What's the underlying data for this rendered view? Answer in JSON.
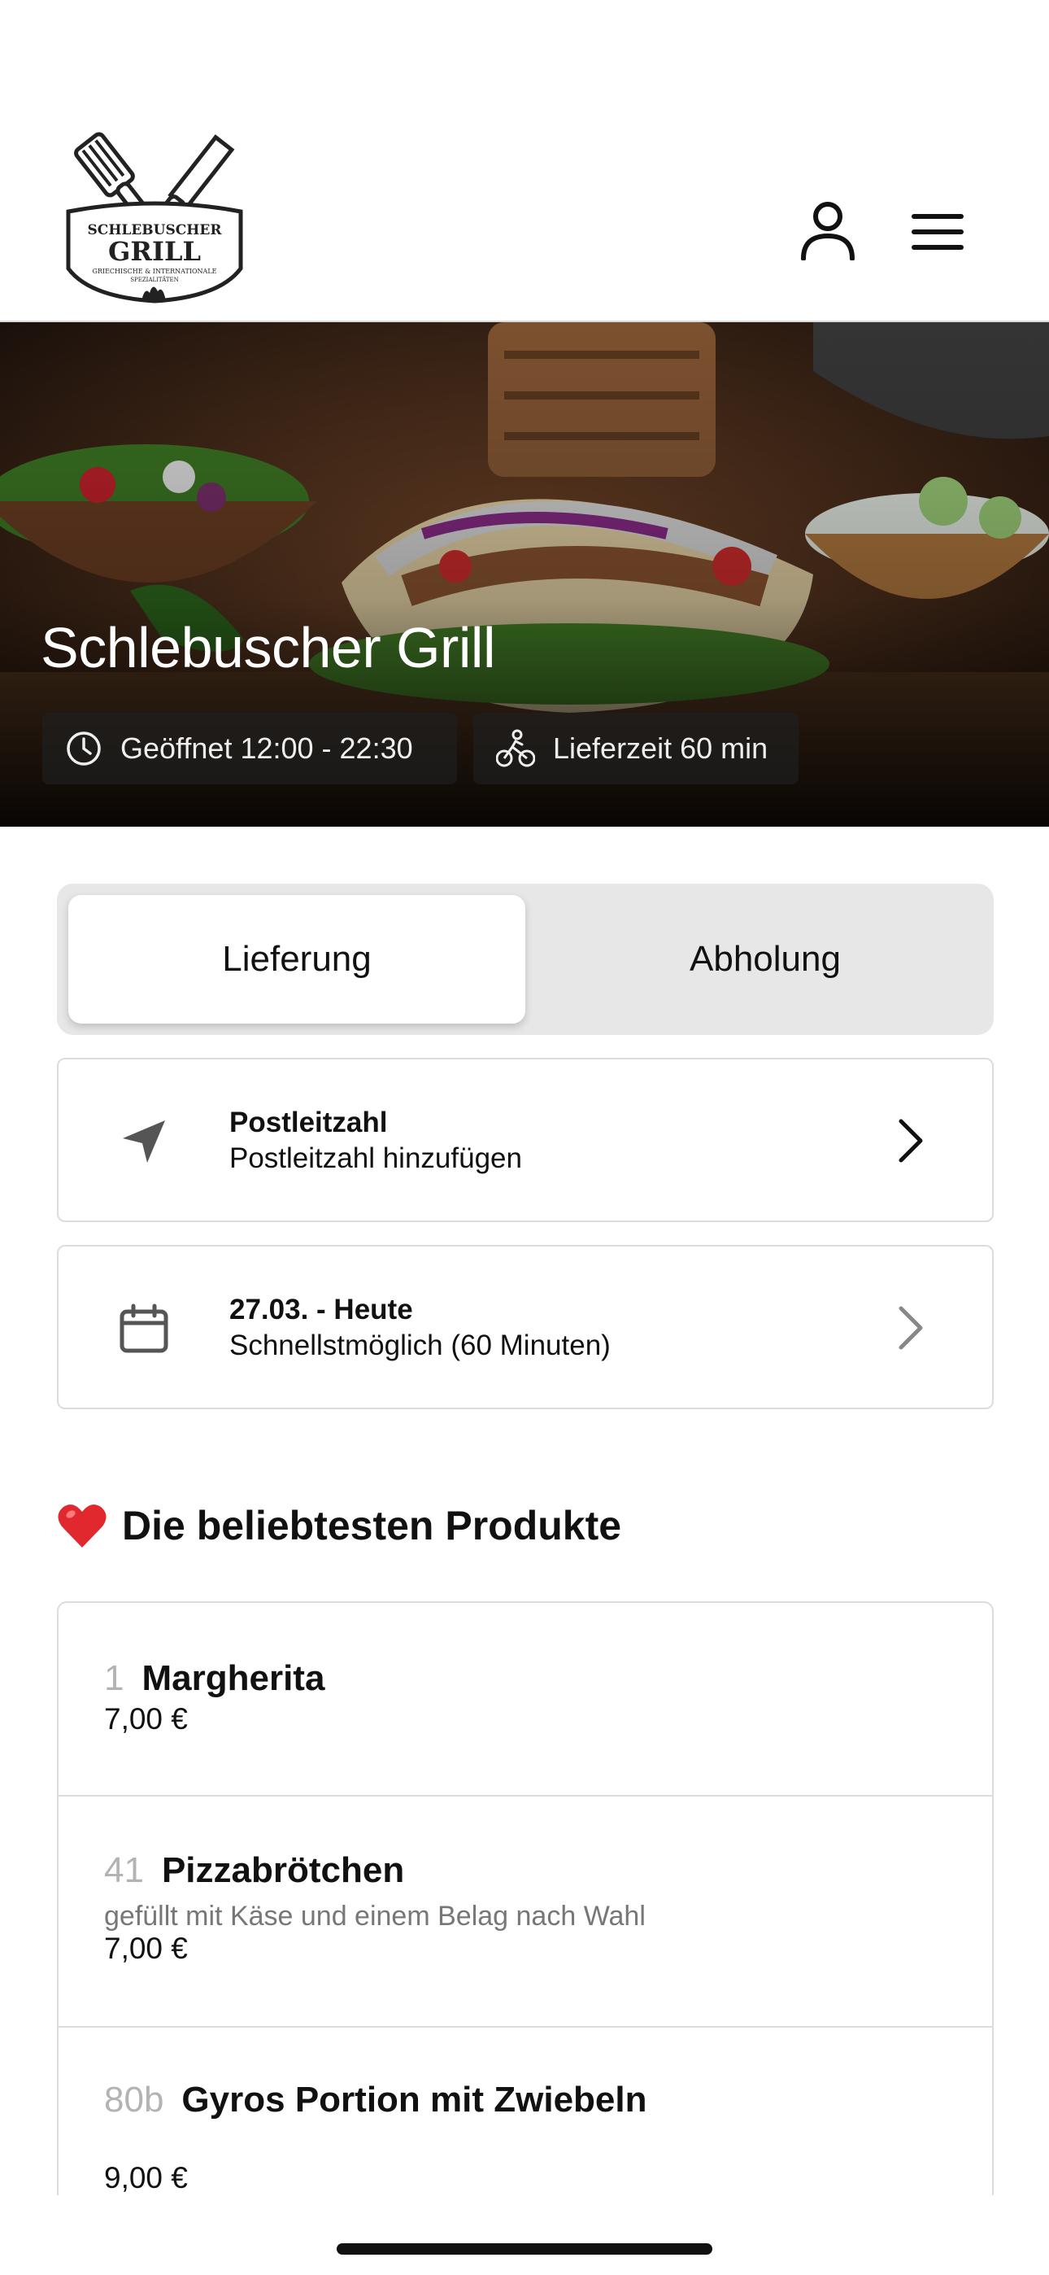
{
  "header": {
    "logo": {
      "brand_top": "SCHLEBUSCHER",
      "brand_main": "GRILL",
      "brand_sub": "GRIECHISCHE & INTERNATIONALE",
      "brand_sub2": "SPEZIALITÄTEN"
    },
    "user_icon": "user-icon",
    "menu_icon": "hamburger-menu-icon"
  },
  "hero": {
    "title": "Schlebuscher Grill",
    "hours_label": "Geöffnet 12:00 - 22:30",
    "delivery_time_label": "Lieferzeit 60 min"
  },
  "order_mode": {
    "tabs": [
      {
        "label": "Lieferung",
        "active": true
      },
      {
        "label": "Abholung",
        "active": false
      }
    ]
  },
  "postcode_card": {
    "title": "Postleitzahl",
    "subtitle": "Postleitzahl hinzufügen",
    "icon": "location-arrow-icon"
  },
  "date_card": {
    "title": "27.03. - Heute",
    "subtitle": "Schnellstmöglich (60 Minuten)",
    "icon": "calendar-icon"
  },
  "popular": {
    "heading": "Die beliebtesten Produkte",
    "icon": "heart-icon",
    "items": [
      {
        "number": "1",
        "name": "Margherita",
        "description": "",
        "price": "7,00 €"
      },
      {
        "number": "41",
        "name": "Pizzabrötchen",
        "description": "gefüllt mit Käse und einem Belag nach Wahl",
        "price": "7,00 €"
      },
      {
        "number": "80b",
        "name": "Gyros Portion mit Zwiebeln",
        "description": "",
        "price": "9,00 €"
      }
    ]
  },
  "colors": {
    "accent_red": "#e0282e",
    "chip_bg": "#1e1e1e",
    "segment_bg": "#e7e7e7",
    "border": "#dcdcdc"
  }
}
